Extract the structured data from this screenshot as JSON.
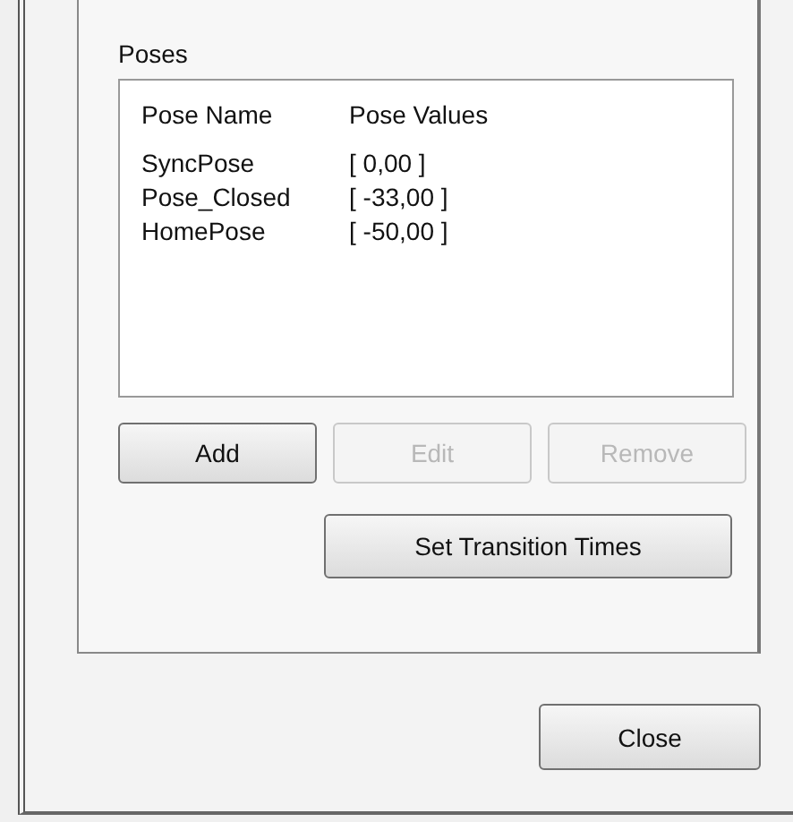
{
  "group": {
    "title": "Poses"
  },
  "list": {
    "columns": [
      "Pose Name",
      "Pose Values"
    ],
    "rows": [
      {
        "name": "SyncPose",
        "values": "[ 0,00 ]"
      },
      {
        "name": "Pose_Closed",
        "values": "[ -33,00 ]"
      },
      {
        "name": "HomePose",
        "values": "[ -50,00 ]"
      }
    ]
  },
  "buttons": [
    {
      "label": "Add",
      "disabled": false
    },
    {
      "label": "Edit",
      "disabled": true
    },
    {
      "label": "Remove",
      "disabled": true
    }
  ],
  "transition_button": {
    "label": "Set Transition Times",
    "disabled": false
  },
  "close_button": {
    "label": "Close",
    "disabled": false
  }
}
